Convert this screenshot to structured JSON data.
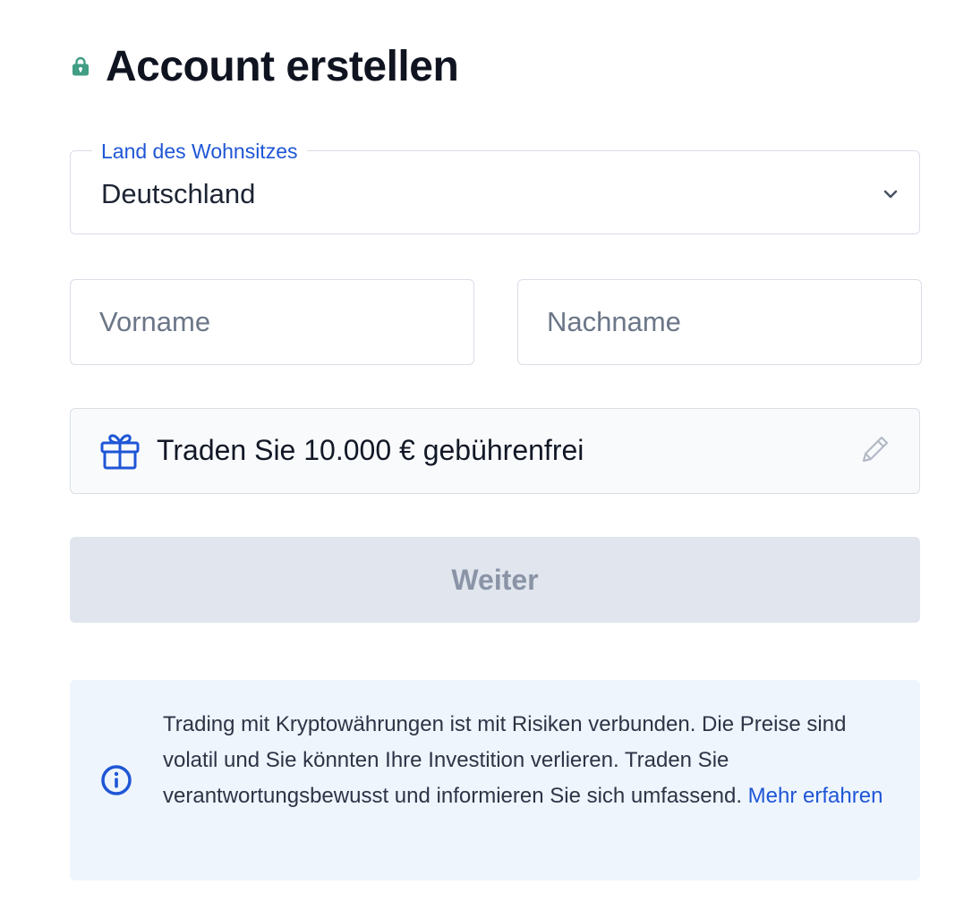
{
  "header": {
    "title": "Account erstellen",
    "icon": "lock-icon",
    "icon_color": "#3f9e84"
  },
  "country": {
    "label": "Land des Wohnsitzes",
    "value": "Deutschland",
    "icon": "chevron-down-icon"
  },
  "name": {
    "first_placeholder": "Vorname",
    "last_placeholder": "Nachname"
  },
  "promo": {
    "text": "Traden Sie 10.000 € gebührenfrei",
    "icon": "gift-icon",
    "edit_icon": "pencil-icon"
  },
  "continue": {
    "label": "Weiter"
  },
  "info": {
    "icon": "info-icon",
    "text": "Trading mit Kryptowährungen ist mit Risiken verbunden. Die Preise sind volatil und Sie könnten Ihre Investition verlieren. Traden Sie verantwortungsbewusst und informieren Sie sich umfassend. ",
    "link": "Mehr erfahren"
  },
  "colors": {
    "accent": "#1f56d6",
    "button_disabled_bg": "#e0e5ee",
    "button_disabled_text": "#8a94a6",
    "info_bg": "#eef5fd"
  }
}
